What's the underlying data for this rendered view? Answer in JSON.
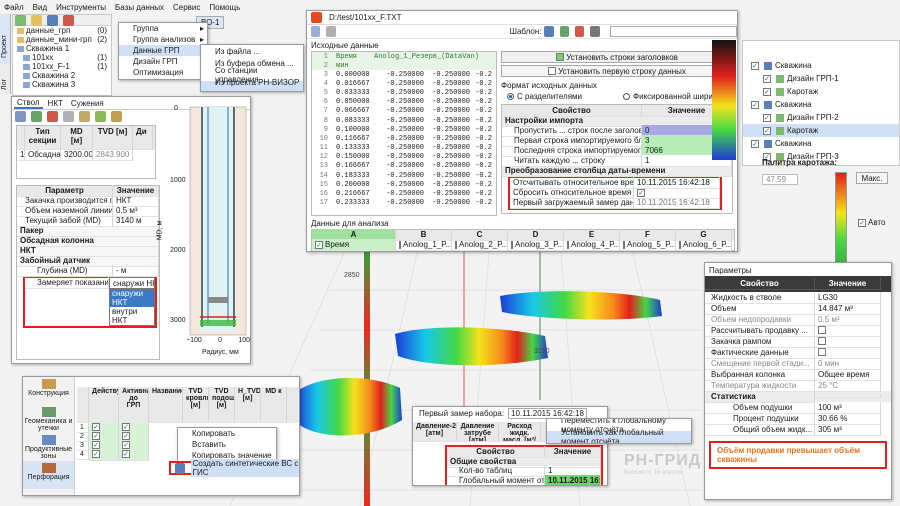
{
  "menubar": [
    "Файл",
    "Вид",
    "Инструменты",
    "Базы данных",
    "Сервис",
    "Помощь"
  ],
  "side_tabs": [
    "Проект",
    "Лог"
  ],
  "tree": {
    "items": [
      {
        "label": "данные_грп",
        "count": "(0)"
      },
      {
        "label": "данные_мини-грп",
        "count": "(2)"
      },
      {
        "label": "Скважина 1",
        "count": ""
      },
      {
        "label": "101хх",
        "count": "(1)"
      },
      {
        "label": "101хх_F-1",
        "count": "(1)"
      },
      {
        "label": "Скважина 2",
        "count": ""
      },
      {
        "label": "Скважина 3",
        "count": ""
      }
    ],
    "tab_label": "ВО-1"
  },
  "context_menu1": {
    "items": [
      "Группа",
      "Группа анализов",
      "Данные ГРП",
      "Дизайн ГРП",
      "Оптимизация"
    ],
    "arrow": "▸"
  },
  "context_menu2": {
    "items": [
      "Из файла ...",
      "Из буфера обмена ...",
      "Со станции управления ...",
      "Из проекта РН-ВИЗОР ..."
    ]
  },
  "import_dialog": {
    "title": "D:/test/101xx_F.TXT",
    "template_label": "Шаблон:",
    "source_label": "Исходные данные",
    "set_header_btn": "Установить строки заголовков",
    "first_row_btn": "Установить первую строку данных",
    "format_label": "Формат исходных данных",
    "radio1": "С разделителями",
    "radio2": "Фиксированной ширины",
    "prop_col": "Свойство",
    "val_col": "Значение",
    "grp1": "Настройки импорта",
    "props1": [
      {
        "name": "Пропустить ... строк после заголовка",
        "value": "0"
      },
      {
        "name": "Первая строка импортируемого блока ...",
        "value": "3"
      },
      {
        "name": "Последняя строка импортируемого блока ...",
        "value": "7066"
      },
      {
        "name": "Читать каждую ... строку",
        "value": "1"
      }
    ],
    "grp2": "Преобразование столбца даты-времени",
    "props2": [
      {
        "name": "Отсчитывать относительное время от",
        "value": "10.11.2015 16:42:18"
      },
      {
        "name": "Сбросить относительное время в 0",
        "value": ""
      },
      {
        "name": "Первый загружаемый замер данных",
        "value": "10.11.2015 16:42:18"
      }
    ],
    "source_header": {
      "num": "1",
      "c1": "Время",
      "c2": "Anolog_1_Резерв_(DataVan)"
    },
    "source_header2": {
      "num": "2",
      "c1": "мин"
    },
    "source_rows": [
      {
        "n": "3",
        "t": "0.000000",
        "a": "-0.250000",
        "b": "-0.250000",
        "c": "-0.2"
      },
      {
        "n": "4",
        "t": "0.016667",
        "a": "-0.250000",
        "b": "-0.250000",
        "c": "-0.2"
      },
      {
        "n": "5",
        "t": "0.033333",
        "a": "-0.250000",
        "b": "-0.250000",
        "c": "-0.2"
      },
      {
        "n": "6",
        "t": "0.050000",
        "a": "-0.250000",
        "b": "-0.250000",
        "c": "-0.2"
      },
      {
        "n": "7",
        "t": "0.066667",
        "a": "-0.250000",
        "b": "-0.250000",
        "c": "-0.2"
      },
      {
        "n": "8",
        "t": "0.083333",
        "a": "-0.250000",
        "b": "-0.250000",
        "c": "-0.2"
      },
      {
        "n": "9",
        "t": "0.100000",
        "a": "-0.250000",
        "b": "-0.250000",
        "c": "-0.2"
      },
      {
        "n": "10",
        "t": "0.116667",
        "a": "-0.250000",
        "b": "-0.250000",
        "c": "-0.2"
      },
      {
        "n": "11",
        "t": "0.133333",
        "a": "-0.250000",
        "b": "-0.250000",
        "c": "-0.2"
      },
      {
        "n": "12",
        "t": "0.150000",
        "a": "-0.250000",
        "b": "-0.250000",
        "c": "-0.2"
      },
      {
        "n": "13",
        "t": "0.166667",
        "a": "-0.250000",
        "b": "-0.250000",
        "c": "-0.2"
      },
      {
        "n": "14",
        "t": "0.183333",
        "a": "-0.250000",
        "b": "-0.250000",
        "c": "-0.2"
      },
      {
        "n": "15",
        "t": "0.200000",
        "a": "-0.250000",
        "b": "-0.250000",
        "c": "-0.2"
      },
      {
        "n": "16",
        "t": "0.216667",
        "a": "-0.250000",
        "b": "-0.250000",
        "c": "-0.2"
      },
      {
        "n": "17",
        "t": "0.233333",
        "a": "-0.250000",
        "b": "-0.250000",
        "c": "-0.2"
      }
    ],
    "analysis_label": "Данные для анализа",
    "analysis_cols": [
      "A",
      "B",
      "C",
      "D",
      "E",
      "F",
      "G"
    ],
    "analysis_row": [
      "Время",
      "Anolog_1_P...",
      "Anolog_2_P...",
      "Anolog_3_P...",
      "Anolog_4_P...",
      "Anolog_5_P...",
      "Anolog_6_P..."
    ]
  },
  "casing_panel": {
    "tabs": [
      "Ствол",
      "НКТ",
      "Сужения"
    ],
    "col1": "Тип секции",
    "col2": "MD [м]",
    "col3": "TVD [м]",
    "col4": "Ди",
    "row1": {
      "num": "1",
      "type": "Обсадна...",
      "md": "3200.000",
      "tvd": "2843.900"
    },
    "prop_col": "Параметр",
    "val_col": "Значение",
    "params": [
      {
        "name": "Закачка производится по",
        "value": "НКТ"
      },
      {
        "name": "Объем наземной линии",
        "value": "0.5 м³"
      },
      {
        "name": "Текущий забой (MD)",
        "value": "3140 м"
      }
    ],
    "groups": [
      "Пакер",
      "Обсадная колонна",
      "НКТ",
      "Забойный датчик"
    ],
    "depth_label": "Глубина (MD)",
    "depth_value": "- м",
    "measure_label": "Замеряет показания",
    "measure_value": "снаружи НК",
    "dropdown": [
      "снаружи НКТ",
      "внутри НКТ"
    ],
    "plot": {
      "y_ticks": [
        "0",
        "1000",
        "2000",
        "3000"
      ],
      "x_ticks": [
        "−100",
        "0",
        "100"
      ],
      "xlabel": "Радиус, мм",
      "ylabel": "MD, м"
    }
  },
  "right_tree": {
    "items": [
      {
        "label": "Скважина",
        "indent": 0
      },
      {
        "label": "Дизайн ГРП-1",
        "indent": 1
      },
      {
        "label": "Каротаж",
        "indent": 1
      },
      {
        "label": "Скважина",
        "indent": 0
      },
      {
        "label": "Дизайн ГРП-2",
        "indent": 1
      },
      {
        "label": "Каротаж",
        "indent": 1
      },
      {
        "label": "Скважина",
        "indent": 0
      },
      {
        "label": "Дизайн ГРП-3",
        "indent": 1
      }
    ],
    "palette_label": "Палитра каротажа:",
    "palette_value": "47.59",
    "max_btn": "Макс.",
    "auto_label": "Авто"
  },
  "params_panel": {
    "title": "Параметры",
    "prop_col": "Свойство",
    "val_col": "Значение",
    "rows": [
      {
        "name": "Жидкость в стволе",
        "value": "LG30",
        "type": "row"
      },
      {
        "name": "Объем",
        "value": "14.847 м³",
        "type": "row"
      },
      {
        "name": "Объем недопродавки",
        "value": "0.5 м³",
        "type": "dim"
      },
      {
        "name": "Рассчитывать продавку ...",
        "value": "",
        "type": "chk"
      },
      {
        "name": "Закачка рампом",
        "value": "",
        "type": "chk"
      },
      {
        "name": "Фактические данные",
        "value": "",
        "type": "chk"
      },
      {
        "name": "Смещение первой стади...",
        "value": "0 мин",
        "type": "dim"
      },
      {
        "name": "Выбранная колонка",
        "value": "Общее время",
        "type": "row"
      },
      {
        "name": "Температура жидкости",
        "value": "25 °С",
        "type": "dim"
      },
      {
        "name": "Статистика",
        "value": "",
        "type": "grp"
      },
      {
        "name": "Объем подушки",
        "value": "100 м³",
        "type": "sub"
      },
      {
        "name": "Процент подушки",
        "value": "30.66 %",
        "type": "sub"
      },
      {
        "name": "Общий объем жидк...",
        "value": "305 м³",
        "type": "sub"
      }
    ],
    "warning": "Объём продавки превышает объём скважины"
  },
  "toolbar_panel": {
    "side_items": [
      "Конструкция",
      "Геомеханика и утечки",
      "Продуктивные зоны",
      "Перфорация"
    ],
    "cols": [
      "Действует",
      "Активна до ГРП",
      "Название",
      "TVD кровли [м]",
      "TVD подош [м]",
      "H_TVD [м]",
      "MD к"
    ],
    "rows": [
      "1",
      "2",
      "3",
      "4"
    ],
    "menu": [
      "Копировать",
      "Вставить",
      "Копировать значение"
    ],
    "create_btn": "Создать синтетические ВС с ГИС"
  },
  "first_meas": {
    "label": "Первый замер набора:",
    "value": "10.11.2015 16:42:18",
    "menu": [
      "Переместить к глобальному моменту отсчёта",
      "Установить как глобальный момент отсчёта"
    ],
    "cols": [
      "Давление-2 [атм]",
      "Давление затрубе [атм]",
      "Расход жидк. масл. [м³/мин]"
    ],
    "prop_col": "Свойство",
    "val_col": "Значение",
    "group": "Общие свойства",
    "rows": [
      {
        "name": "Кол-во таблиц",
        "value": "1"
      },
      {
        "name": "Глобальный момент отсчёта",
        "value": "10.11.2015 16:42:18"
      }
    ]
  },
  "scene": {
    "depth_labels": [
      "2850",
      "2900",
      "2950",
      "3000",
      "3050",
      "3100",
      "3150",
      "3200",
      "3250",
      "3300"
    ],
    "watermark": "РН-ГРИД",
    "watermark_sub": "Версия от 16 апреля"
  },
  "colors": {
    "accent": "#3c78c8",
    "highlight": "#e0201c",
    "green": "#6fd36f",
    "purple": "#a9a7e8"
  }
}
